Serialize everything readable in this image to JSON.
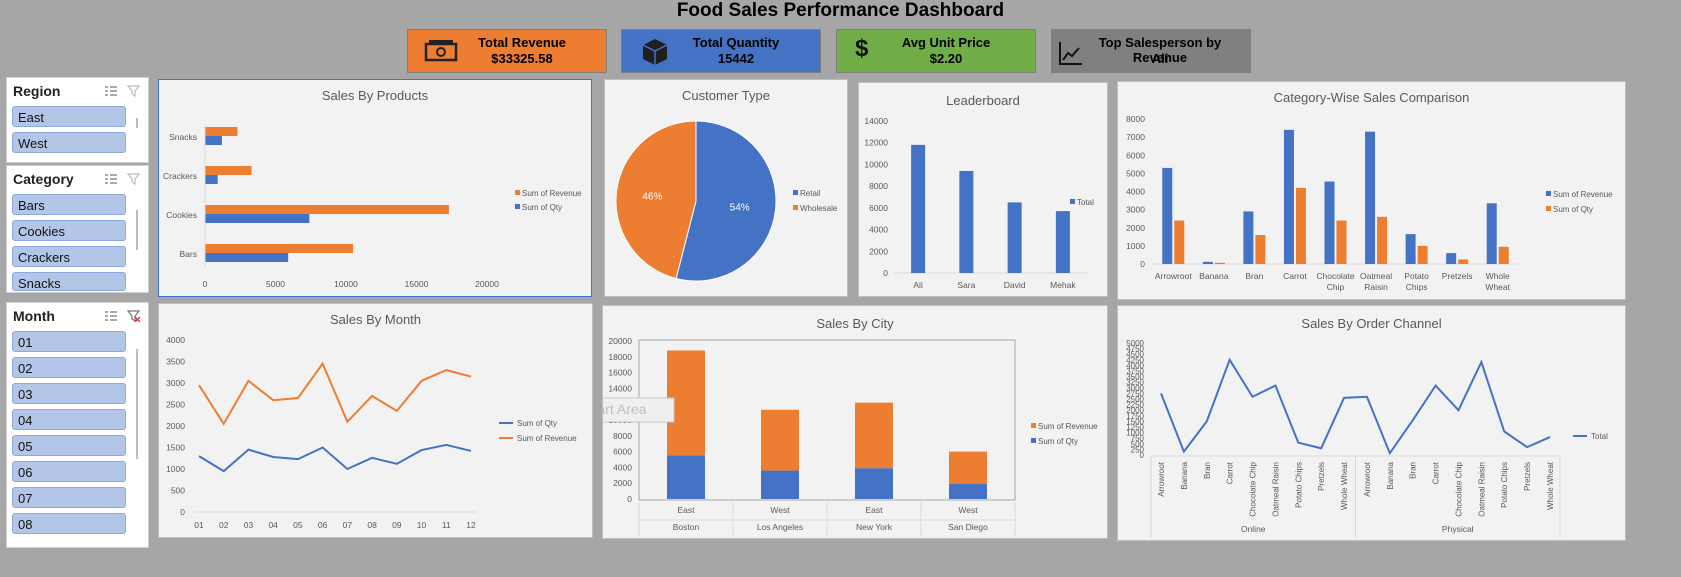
{
  "dashboard": {
    "title": "Food Sales Performance Dashboard"
  },
  "kpis": [
    {
      "label": "Total Revenue",
      "value": "$33325.58",
      "icon": "money-icon",
      "color": "#ed7d31"
    },
    {
      "label": "Total Quantity",
      "value": "15442",
      "icon": "box-icon",
      "color": "#4472c4"
    },
    {
      "label": "Avg Unit Price",
      "value": "$2.20",
      "icon": "dollar-icon",
      "color": "#70ad47"
    },
    {
      "label": "Top Salesperson by Revenue",
      "value": "Ali",
      "icon": "trend-icon",
      "color": "#808080"
    }
  ],
  "slicers": {
    "region": {
      "title": "Region",
      "items": [
        "East",
        "West"
      ]
    },
    "category": {
      "title": "Category",
      "items": [
        "Bars",
        "Cookies",
        "Crackers",
        "Snacks"
      ]
    },
    "month": {
      "title": "Month",
      "items": [
        "01",
        "02",
        "03",
        "04",
        "05",
        "06",
        "07",
        "08"
      ]
    }
  },
  "colors": {
    "revenue": "#ed7d31",
    "qty": "#4472c4"
  },
  "tooltip": "Chart Area",
  "chart_data": [
    {
      "id": "products",
      "type": "bar",
      "orientation": "horizontal",
      "title": "Sales By Products",
      "categories": [
        "Bars",
        "Cookies",
        "Crackers",
        "Snacks"
      ],
      "series": [
        {
          "name": "Sum of Revenue",
          "values": [
            10500,
            17300,
            3300,
            2300
          ]
        },
        {
          "name": "Sum of Qty",
          "values": [
            5900,
            7400,
            900,
            1200
          ]
        }
      ],
      "xticks": [
        "0",
        "5000",
        "10000",
        "15000",
        "20000"
      ],
      "xlim": [
        0,
        20000
      ]
    },
    {
      "id": "customer",
      "type": "pie",
      "title": "Customer Type",
      "labels": [
        "Retail",
        "Wholesale"
      ],
      "values": [
        54,
        46
      ],
      "data_labels": [
        "54%",
        "46%"
      ]
    },
    {
      "id": "leaderboard",
      "type": "bar",
      "title": "Leaderboard",
      "categories": [
        "Ali",
        "Sara",
        "David",
        "Mehak"
      ],
      "series": [
        {
          "name": "Total",
          "values": [
            11800,
            9400,
            6500,
            5700
          ]
        }
      ],
      "yticks": [
        "0",
        "2000",
        "4000",
        "6000",
        "8000",
        "10000",
        "12000",
        "14000"
      ],
      "ylim": [
        0,
        14000
      ]
    },
    {
      "id": "catwise",
      "type": "bar",
      "title": "Category-Wise Sales Comparison",
      "categories": [
        "Arrowroot",
        "Banana",
        "Bran",
        "Carrot",
        "Chocolate Chip",
        "Oatmeal Raisin",
        "Potato Chips",
        "Pretzels",
        "Whole Wheat"
      ],
      "series": [
        {
          "name": "Sum of Revenue",
          "values": [
            5300,
            120,
            2900,
            7400,
            4550,
            7300,
            1650,
            600,
            3350
          ]
        },
        {
          "name": "Sum of Qty",
          "values": [
            2400,
            70,
            1600,
            4200,
            2400,
            2600,
            1000,
            250,
            950
          ]
        }
      ],
      "yticks": [
        "0",
        "1000",
        "2000",
        "3000",
        "4000",
        "5000",
        "6000",
        "7000",
        "8000"
      ],
      "ylim": [
        0,
        8000
      ]
    },
    {
      "id": "month",
      "type": "line",
      "title": "Sales By Month",
      "x": [
        "01",
        "02",
        "03",
        "04",
        "05",
        "06",
        "07",
        "08",
        "09",
        "10",
        "11",
        "12"
      ],
      "series": [
        {
          "name": "Sum of Qty",
          "values": [
            1300,
            950,
            1450,
            1280,
            1230,
            1500,
            1000,
            1260,
            1120,
            1440,
            1560,
            1420
          ]
        },
        {
          "name": "Sum of Revenue",
          "values": [
            2950,
            2050,
            3050,
            2600,
            2650,
            3450,
            2100,
            2700,
            2350,
            3050,
            3300,
            3150
          ]
        }
      ],
      "yticks": [
        "0",
        "500",
        "1000",
        "1500",
        "2000",
        "2500",
        "3000",
        "3500",
        "4000"
      ],
      "ylim": [
        0,
        4000
      ]
    },
    {
      "id": "city",
      "type": "bar",
      "stacked": true,
      "title": "Sales By City",
      "categories": [
        "East",
        "West",
        "East",
        "West"
      ],
      "groups": [
        "Boston",
        "Los Angeles",
        "New York",
        "San Diego"
      ],
      "series": [
        {
          "name": "Sum of Qty",
          "values": [
            5500,
            3600,
            3900,
            1900
          ]
        },
        {
          "name": "Sum of Revenue",
          "values": [
            13300,
            7700,
            8300,
            4100
          ]
        }
      ],
      "legend": [
        "Sum of Revenue",
        "Sum of Qty"
      ],
      "yticks": [
        "0",
        "2000",
        "4000",
        "6000",
        "8000",
        "10000",
        "12000",
        "14000",
        "16000",
        "18000",
        "20000"
      ],
      "ylim": [
        0,
        20000
      ]
    },
    {
      "id": "channel",
      "type": "line",
      "title": "Sales By Order Channel",
      "x": [
        "Arrowroot",
        "Banana",
        "Bran",
        "Carrot",
        "Chocolate Chip",
        "Oatmeal Raisin",
        "Potato Chips",
        "Pretzels",
        "Whole Wheat",
        "Arrowroot",
        "Banana",
        "Bran",
        "Carrot",
        "Chocolate Chip",
        "Oatmeal Raisin",
        "Potato Chips",
        "Pretzels",
        "Whole Wheat"
      ],
      "groups": [
        "Online",
        "Physical"
      ],
      "series": [
        {
          "name": "Total",
          "values": [
            2750,
            150,
            1500,
            4250,
            2600,
            3100,
            550,
            300,
            2550,
            2600,
            80,
            1550,
            3100,
            2000,
            4150,
            1050,
            350,
            800
          ]
        }
      ],
      "yticks": [
        "0",
        "250",
        "500",
        "750",
        "1000",
        "1250",
        "1500",
        "1750",
        "2000",
        "2250",
        "2500",
        "2750",
        "3000",
        "3250",
        "3500",
        "3750",
        "4000",
        "4250",
        "4500",
        "4750",
        "5000"
      ],
      "ylim": [
        0,
        5000
      ]
    }
  ]
}
